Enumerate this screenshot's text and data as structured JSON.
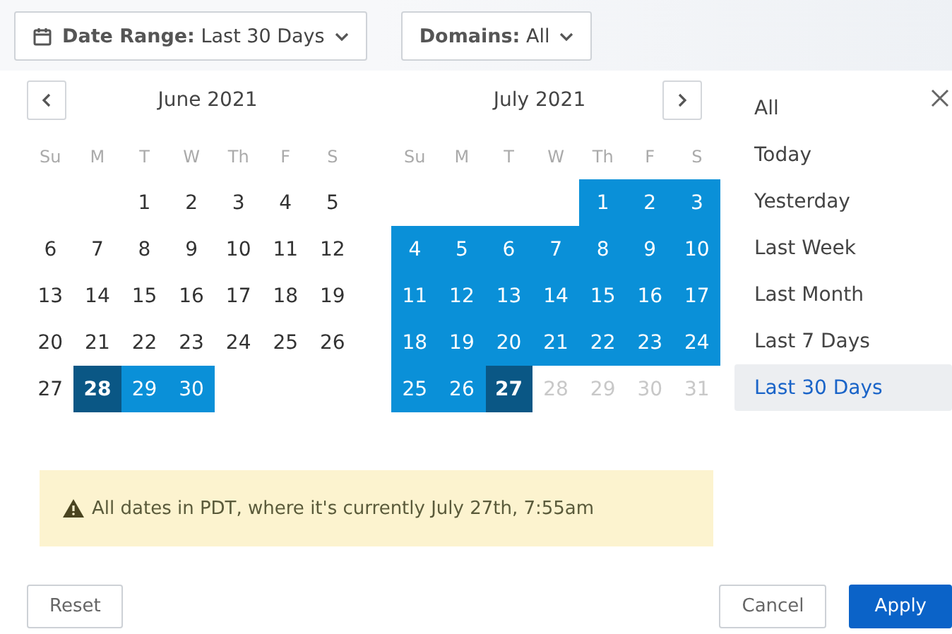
{
  "filters": [
    {
      "kind": "date",
      "label": "Date Range:",
      "value": "Last 30 Days"
    },
    {
      "kind": "plain",
      "label": "Domains:",
      "value": "All"
    }
  ],
  "months": [
    {
      "title": "June 2021",
      "weekdays": [
        "Su",
        "M",
        "T",
        "W",
        "Th",
        "F",
        "S"
      ],
      "days": [
        {
          "kind": "blank"
        },
        {
          "kind": "blank"
        },
        {
          "day": "1",
          "in_range": false,
          "endpoint": false,
          "disabled": false
        },
        {
          "day": "2",
          "in_range": false,
          "endpoint": false,
          "disabled": false
        },
        {
          "day": "3",
          "in_range": false,
          "endpoint": false,
          "disabled": false
        },
        {
          "day": "4",
          "in_range": false,
          "endpoint": false,
          "disabled": false
        },
        {
          "day": "5",
          "in_range": false,
          "endpoint": false,
          "disabled": false
        },
        {
          "day": "6",
          "in_range": false,
          "endpoint": false,
          "disabled": false
        },
        {
          "day": "7",
          "in_range": false,
          "endpoint": false,
          "disabled": false
        },
        {
          "day": "8",
          "in_range": false,
          "endpoint": false,
          "disabled": false
        },
        {
          "day": "9",
          "in_range": false,
          "endpoint": false,
          "disabled": false
        },
        {
          "day": "10",
          "in_range": false,
          "endpoint": false,
          "disabled": false
        },
        {
          "day": "11",
          "in_range": false,
          "endpoint": false,
          "disabled": false
        },
        {
          "day": "12",
          "in_range": false,
          "endpoint": false,
          "disabled": false
        },
        {
          "day": "13",
          "in_range": false,
          "endpoint": false,
          "disabled": false
        },
        {
          "day": "14",
          "in_range": false,
          "endpoint": false,
          "disabled": false
        },
        {
          "day": "15",
          "in_range": false,
          "endpoint": false,
          "disabled": false
        },
        {
          "day": "16",
          "in_range": false,
          "endpoint": false,
          "disabled": false
        },
        {
          "day": "17",
          "in_range": false,
          "endpoint": false,
          "disabled": false
        },
        {
          "day": "18",
          "in_range": false,
          "endpoint": false,
          "disabled": false
        },
        {
          "day": "19",
          "in_range": false,
          "endpoint": false,
          "disabled": false
        },
        {
          "day": "20",
          "in_range": false,
          "endpoint": false,
          "disabled": false
        },
        {
          "day": "21",
          "in_range": false,
          "endpoint": false,
          "disabled": false
        },
        {
          "day": "22",
          "in_range": false,
          "endpoint": false,
          "disabled": false
        },
        {
          "day": "23",
          "in_range": false,
          "endpoint": false,
          "disabled": false
        },
        {
          "day": "24",
          "in_range": false,
          "endpoint": false,
          "disabled": false
        },
        {
          "day": "25",
          "in_range": false,
          "endpoint": false,
          "disabled": false
        },
        {
          "day": "26",
          "in_range": false,
          "endpoint": false,
          "disabled": false
        },
        {
          "day": "27",
          "in_range": false,
          "endpoint": false,
          "disabled": false
        },
        {
          "day": "28",
          "in_range": true,
          "endpoint": true,
          "disabled": false
        },
        {
          "day": "29",
          "in_range": true,
          "endpoint": false,
          "disabled": false
        },
        {
          "day": "30",
          "in_range": true,
          "endpoint": false,
          "disabled": false
        }
      ]
    },
    {
      "title": "July 2021",
      "weekdays": [
        "Su",
        "M",
        "T",
        "W",
        "Th",
        "F",
        "S"
      ],
      "days": [
        {
          "kind": "blank"
        },
        {
          "kind": "blank"
        },
        {
          "kind": "blank"
        },
        {
          "kind": "blank"
        },
        {
          "day": "1",
          "in_range": true,
          "endpoint": false,
          "disabled": false
        },
        {
          "day": "2",
          "in_range": true,
          "endpoint": false,
          "disabled": false
        },
        {
          "day": "3",
          "in_range": true,
          "endpoint": false,
          "disabled": false
        },
        {
          "day": "4",
          "in_range": true,
          "endpoint": false,
          "disabled": false
        },
        {
          "day": "5",
          "in_range": true,
          "endpoint": false,
          "disabled": false
        },
        {
          "day": "6",
          "in_range": true,
          "endpoint": false,
          "disabled": false
        },
        {
          "day": "7",
          "in_range": true,
          "endpoint": false,
          "disabled": false
        },
        {
          "day": "8",
          "in_range": true,
          "endpoint": false,
          "disabled": false
        },
        {
          "day": "9",
          "in_range": true,
          "endpoint": false,
          "disabled": false
        },
        {
          "day": "10",
          "in_range": true,
          "endpoint": false,
          "disabled": false
        },
        {
          "day": "11",
          "in_range": true,
          "endpoint": false,
          "disabled": false
        },
        {
          "day": "12",
          "in_range": true,
          "endpoint": false,
          "disabled": false
        },
        {
          "day": "13",
          "in_range": true,
          "endpoint": false,
          "disabled": false
        },
        {
          "day": "14",
          "in_range": true,
          "endpoint": false,
          "disabled": false
        },
        {
          "day": "15",
          "in_range": true,
          "endpoint": false,
          "disabled": false
        },
        {
          "day": "16",
          "in_range": true,
          "endpoint": false,
          "disabled": false
        },
        {
          "day": "17",
          "in_range": true,
          "endpoint": false,
          "disabled": false
        },
        {
          "day": "18",
          "in_range": true,
          "endpoint": false,
          "disabled": false
        },
        {
          "day": "19",
          "in_range": true,
          "endpoint": false,
          "disabled": false
        },
        {
          "day": "20",
          "in_range": true,
          "endpoint": false,
          "disabled": false
        },
        {
          "day": "21",
          "in_range": true,
          "endpoint": false,
          "disabled": false
        },
        {
          "day": "22",
          "in_range": true,
          "endpoint": false,
          "disabled": false
        },
        {
          "day": "23",
          "in_range": true,
          "endpoint": false,
          "disabled": false
        },
        {
          "day": "24",
          "in_range": true,
          "endpoint": false,
          "disabled": false
        },
        {
          "day": "25",
          "in_range": true,
          "endpoint": false,
          "disabled": false
        },
        {
          "day": "26",
          "in_range": true,
          "endpoint": false,
          "disabled": false
        },
        {
          "day": "27",
          "in_range": true,
          "endpoint": true,
          "disabled": false
        },
        {
          "day": "28",
          "in_range": false,
          "endpoint": false,
          "disabled": true
        },
        {
          "day": "29",
          "in_range": false,
          "endpoint": false,
          "disabled": true
        },
        {
          "day": "30",
          "in_range": false,
          "endpoint": false,
          "disabled": true
        },
        {
          "day": "31",
          "in_range": false,
          "endpoint": false,
          "disabled": true
        }
      ]
    }
  ],
  "presets": [
    {
      "label": "All",
      "selected": false
    },
    {
      "label": "Today",
      "selected": false
    },
    {
      "label": "Yesterday",
      "selected": false
    },
    {
      "label": "Last Week",
      "selected": false
    },
    {
      "label": "Last Month",
      "selected": false
    },
    {
      "label": "Last 7 Days",
      "selected": false
    },
    {
      "label": "Last 30 Days",
      "selected": true
    }
  ],
  "notice": "All dates in PDT, where it's currently July 27th, 7:55am",
  "buttons": [
    {
      "label": "Reset",
      "kind": "secondary"
    },
    {
      "label": "Cancel",
      "kind": "secondary"
    },
    {
      "label": "Apply",
      "kind": "primary"
    }
  ]
}
